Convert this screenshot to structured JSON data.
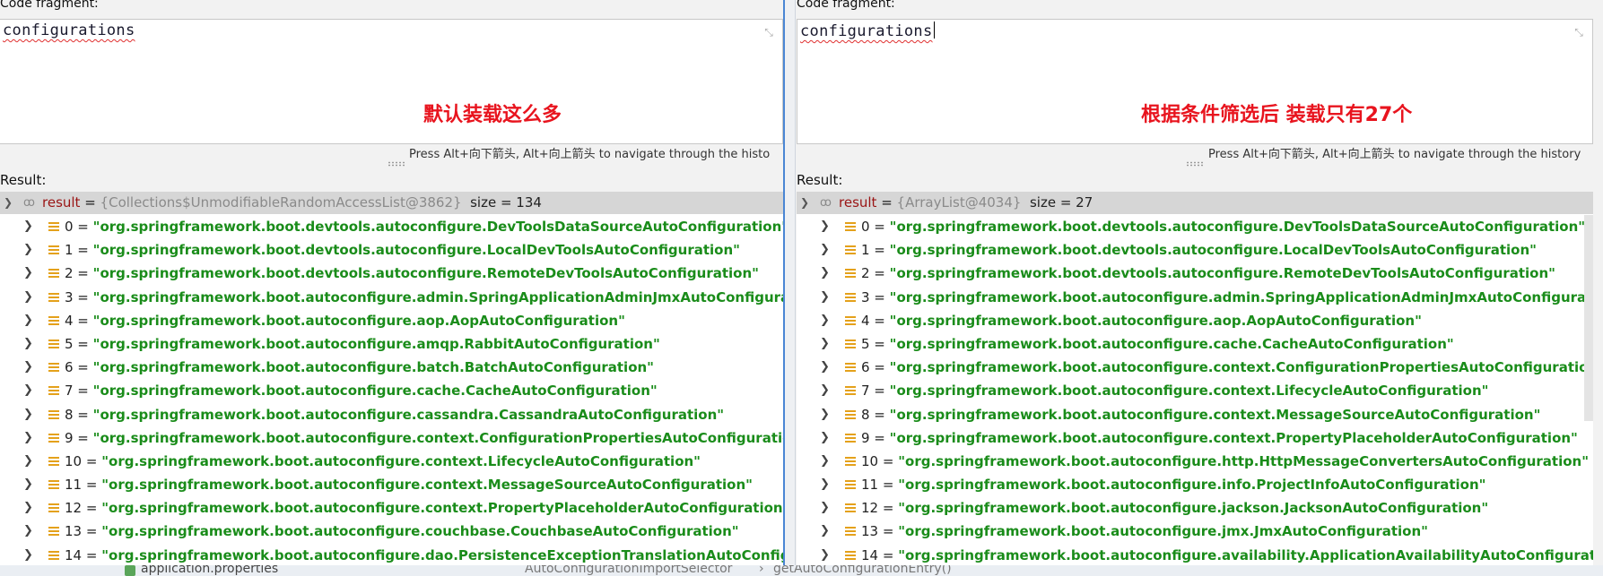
{
  "left": {
    "code_label": "Code fragment:",
    "code_text": "configurations",
    "annotation": "默认装载这么多",
    "hint": "Press Alt+向下箭头, Alt+向上箭头 to navigate through the histo",
    "result_label": "Result:",
    "root": {
      "name": "result",
      "equals": " = ",
      "type": "{Collections$UnmodifiableRandomAccessList@3862}",
      "size": "size = 134"
    },
    "items": [
      {
        "index": "0 = ",
        "value": "\"org.springframework.boot.devtools.autoconfigure.DevToolsDataSourceAutoConfiguration\""
      },
      {
        "index": "1 = ",
        "value": "\"org.springframework.boot.devtools.autoconfigure.LocalDevToolsAutoConfiguration\""
      },
      {
        "index": "2 = ",
        "value": "\"org.springframework.boot.devtools.autoconfigure.RemoteDevToolsAutoConfiguration\""
      },
      {
        "index": "3 = ",
        "value": "\"org.springframework.boot.autoconfigure.admin.SpringApplicationAdminJmxAutoConfiguration\""
      },
      {
        "index": "4 = ",
        "value": "\"org.springframework.boot.autoconfigure.aop.AopAutoConfiguration\""
      },
      {
        "index": "5 = ",
        "value": "\"org.springframework.boot.autoconfigure.amqp.RabbitAutoConfiguration\""
      },
      {
        "index": "6 = ",
        "value": "\"org.springframework.boot.autoconfigure.batch.BatchAutoConfiguration\""
      },
      {
        "index": "7 = ",
        "value": "\"org.springframework.boot.autoconfigure.cache.CacheAutoConfiguration\""
      },
      {
        "index": "8 = ",
        "value": "\"org.springframework.boot.autoconfigure.cassandra.CassandraAutoConfiguration\""
      },
      {
        "index": "9 = ",
        "value": "\"org.springframework.boot.autoconfigure.context.ConfigurationPropertiesAutoConfiguration\""
      },
      {
        "index": "10 = ",
        "value": "\"org.springframework.boot.autoconfigure.context.LifecycleAutoConfiguration\""
      },
      {
        "index": "11 = ",
        "value": "\"org.springframework.boot.autoconfigure.context.MessageSourceAutoConfiguration\""
      },
      {
        "index": "12 = ",
        "value": "\"org.springframework.boot.autoconfigure.context.PropertyPlaceholderAutoConfiguration\""
      },
      {
        "index": "13 = ",
        "value": "\"org.springframework.boot.autoconfigure.couchbase.CouchbaseAutoConfiguration\""
      },
      {
        "index": "14 = ",
        "value": "\"org.springframework.boot.autoconfigure.dao.PersistenceExceptionTranslationAutoConfiguration\""
      }
    ]
  },
  "right": {
    "code_label": "Code fragment:",
    "code_text": "configurations",
    "annotation": "根据条件筛选后 装载只有27个",
    "hint": "Press Alt+向下箭头, Alt+向上箭头 to navigate through the history",
    "result_label": "Result:",
    "root": {
      "name": "result",
      "equals": " = ",
      "type": "{ArrayList@4034}",
      "size": "size = 27"
    },
    "items": [
      {
        "index": "0 = ",
        "value": "\"org.springframework.boot.devtools.autoconfigure.DevToolsDataSourceAutoConfiguration\""
      },
      {
        "index": "1 = ",
        "value": "\"org.springframework.boot.devtools.autoconfigure.LocalDevToolsAutoConfiguration\""
      },
      {
        "index": "2 = ",
        "value": "\"org.springframework.boot.devtools.autoconfigure.RemoteDevToolsAutoConfiguration\""
      },
      {
        "index": "3 = ",
        "value": "\"org.springframework.boot.autoconfigure.admin.SpringApplicationAdminJmxAutoConfiguration\""
      },
      {
        "index": "4 = ",
        "value": "\"org.springframework.boot.autoconfigure.aop.AopAutoConfiguration\""
      },
      {
        "index": "5 = ",
        "value": "\"org.springframework.boot.autoconfigure.cache.CacheAutoConfiguration\""
      },
      {
        "index": "6 = ",
        "value": "\"org.springframework.boot.autoconfigure.context.ConfigurationPropertiesAutoConfiguration\""
      },
      {
        "index": "7 = ",
        "value": "\"org.springframework.boot.autoconfigure.context.LifecycleAutoConfiguration\""
      },
      {
        "index": "8 = ",
        "value": "\"org.springframework.boot.autoconfigure.context.MessageSourceAutoConfiguration\""
      },
      {
        "index": "9 = ",
        "value": "\"org.springframework.boot.autoconfigure.context.PropertyPlaceholderAutoConfiguration\""
      },
      {
        "index": "10 = ",
        "value": "\"org.springframework.boot.autoconfigure.http.HttpMessageConvertersAutoConfiguration\""
      },
      {
        "index": "11 = ",
        "value": "\"org.springframework.boot.autoconfigure.info.ProjectInfoAutoConfiguration\""
      },
      {
        "index": "12 = ",
        "value": "\"org.springframework.boot.autoconfigure.jackson.JacksonAutoConfiguration\""
      },
      {
        "index": "13 = ",
        "value": "\"org.springframework.boot.autoconfigure.jmx.JmxAutoConfiguration\""
      },
      {
        "index": "14 = ",
        "value": "\"org.springframework.boot.autoconfigure.availability.ApplicationAvailabilityAutoConfiguration\""
      }
    ]
  },
  "bottom": {
    "file_tab": "application.properties",
    "breadcrumb_class": "AutoConfigurationImportSelector",
    "breadcrumb_sep": "›",
    "breadcrumb_method": "getAutoConfigurationEntry()"
  },
  "colors": {
    "annotation": "#e8141e",
    "string_value": "#1a8c1a",
    "result_keyword": "#9a1515",
    "field_icon": "#e4a11b"
  },
  "icons": {
    "expand": "chevron-right-icon",
    "collapse": "chevron-down-icon",
    "watch": "watch-glasses-icon",
    "field": "field-list-icon",
    "shrink": "collapse-arrows-icon"
  }
}
